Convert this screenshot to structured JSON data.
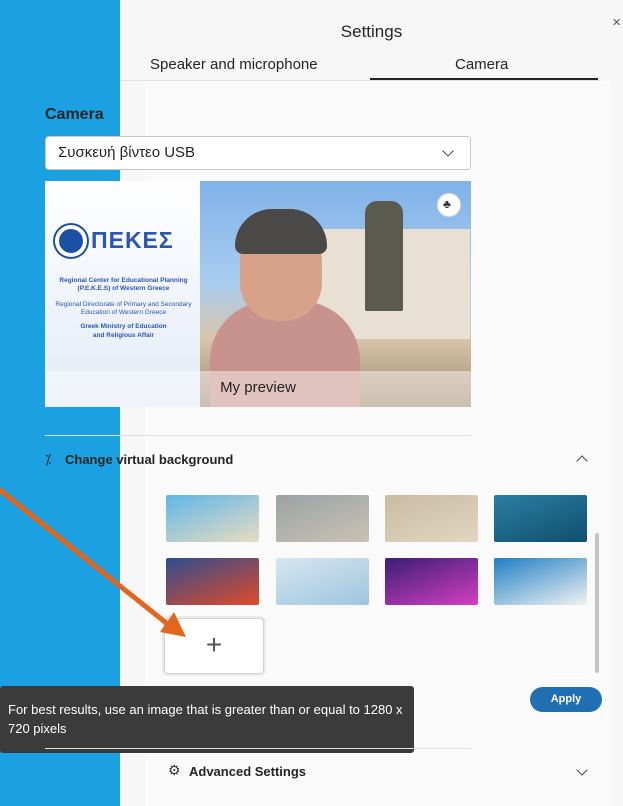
{
  "dialog": {
    "title": "Settings",
    "close_label": "×",
    "tabs": [
      {
        "label": "Speaker and microphone",
        "active": false
      },
      {
        "label": "Camera",
        "active": true
      }
    ]
  },
  "camera": {
    "section_title": "Camera",
    "device": "Συσκευή βίντεο USB",
    "preview_caption": "My preview",
    "preview_background": {
      "logo_text": "ΠΕΚΕΣ",
      "lines": [
        "Regional Center for Educational Planning",
        "(P.E.K.E.S) of Western Greece",
        "Regional Directorate of Primary and Secondary",
        "Education of Western Greece",
        "Greek Ministry of Education",
        "and Religious Affair"
      ]
    }
  },
  "virtual_background": {
    "label": "Change virtual background",
    "expanded": true,
    "thumbnails": [
      {
        "name": "beach",
        "colors": [
          "#5fb6e8",
          "#e9dcc0"
        ]
      },
      {
        "name": "blurred-office",
        "colors": [
          "#9aa3a5",
          "#c9c2b4"
        ]
      },
      {
        "name": "sunlit-wall",
        "colors": [
          "#c9bba4",
          "#e2d6c0"
        ]
      },
      {
        "name": "mountains",
        "colors": [
          "#2a7fa3",
          "#0f4f6d"
        ]
      },
      {
        "name": "abstract-red",
        "colors": [
          "#2f4d8f",
          "#e04a2a"
        ]
      },
      {
        "name": "minimal-room",
        "colors": [
          "#d6e6f1",
          "#9ec5de"
        ]
      },
      {
        "name": "neon-space",
        "colors": [
          "#3a1d78",
          "#d43fbf"
        ]
      },
      {
        "name": "custom-pekes",
        "colors": [
          "#1f7fc4",
          "#f2f2f2"
        ]
      }
    ],
    "add_label": "+",
    "apply_label": "Apply",
    "tooltip": "For best results, use an image that is greater than or equal to 1280 x 720 pixels"
  },
  "advanced": {
    "label": "Advanced Settings"
  },
  "colors": {
    "accent": "#1f6fb2",
    "annotation_arrow": "#e2671d",
    "left_strip": "#1ba1e2"
  }
}
